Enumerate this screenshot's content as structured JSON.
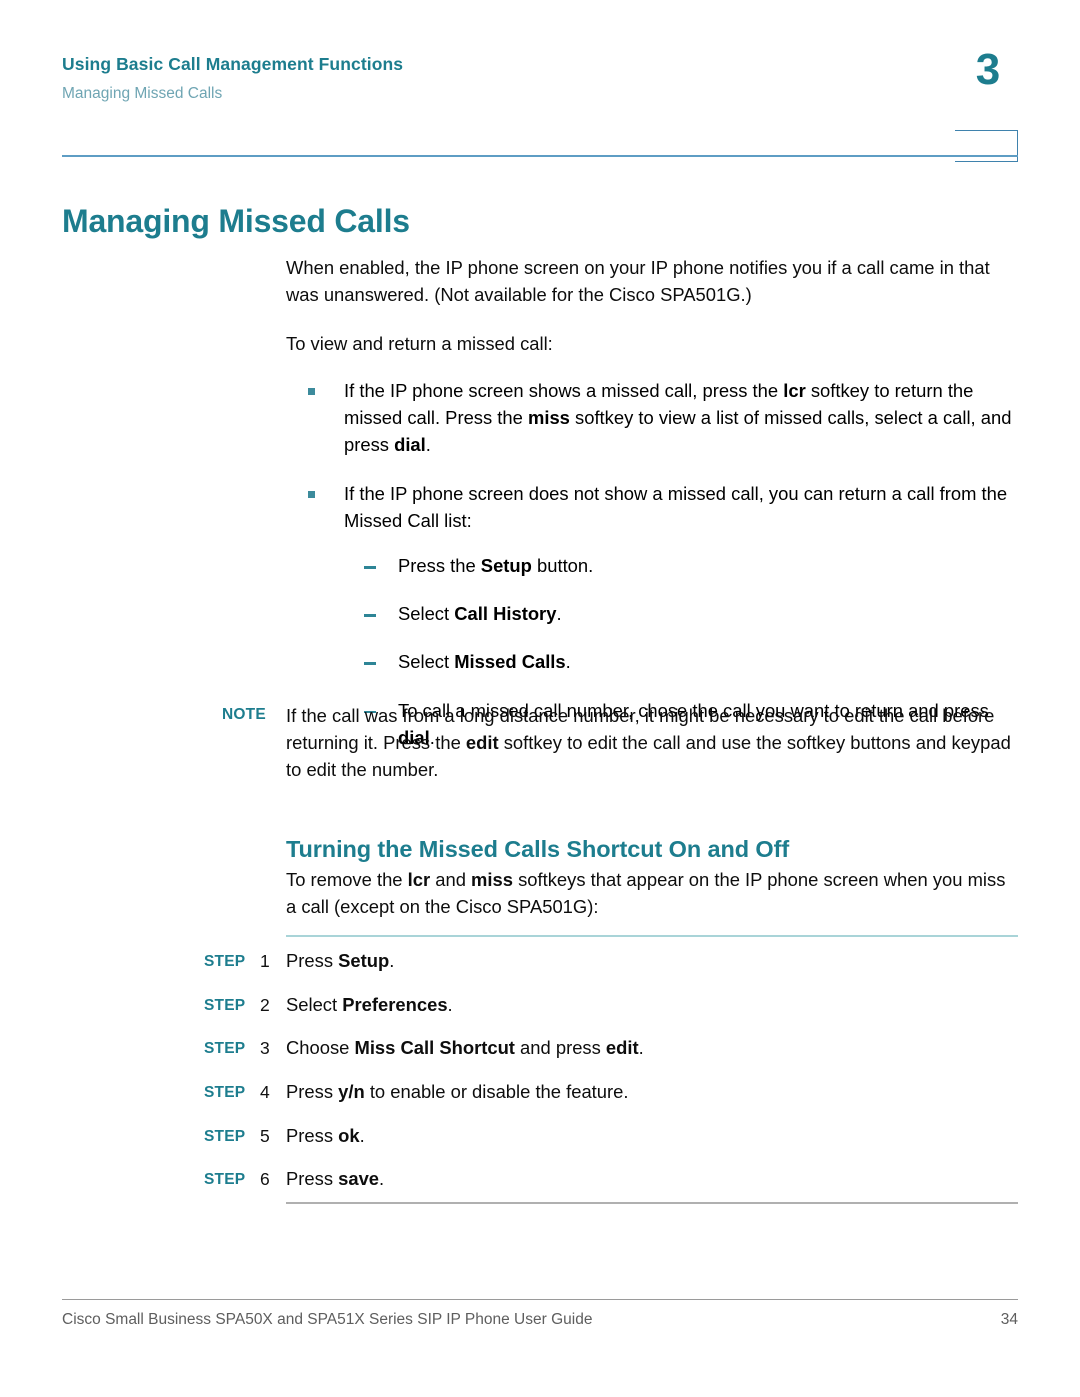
{
  "header": {
    "running_title": "Using Basic Call Management Functions",
    "running_subtitle": "Managing Missed Calls",
    "chapter_number": "3"
  },
  "page_title": "Managing Missed Calls",
  "body": {
    "intro_paragraph": "When enabled, the IP phone screen on your IP phone notifies you if a call came in that was unanswered. (Not available for the Cisco SPA501G.)",
    "lead_in": "To view and return a missed call:",
    "bullets": [
      {
        "segments": [
          {
            "text": "If the IP phone screen shows a missed call, press the ",
            "bold": false
          },
          {
            "text": "lcr",
            "bold": true
          },
          {
            "text": " softkey to return the missed call. Press the ",
            "bold": false
          },
          {
            "text": "miss",
            "bold": true
          },
          {
            "text": " softkey to view a list of missed calls, select a call, and press ",
            "bold": false
          },
          {
            "text": "dial",
            "bold": true
          },
          {
            "text": ".",
            "bold": false
          }
        ]
      },
      {
        "segments": [
          {
            "text": "If the IP phone screen does not show a missed call, you can return a call from the Missed Call list:",
            "bold": false
          }
        ],
        "sub_items": [
          [
            {
              "text": "Press the ",
              "bold": false
            },
            {
              "text": "Setup",
              "bold": true
            },
            {
              "text": " button.",
              "bold": false
            }
          ],
          [
            {
              "text": "Select ",
              "bold": false
            },
            {
              "text": "Call History",
              "bold": true
            },
            {
              "text": ".",
              "bold": false
            }
          ],
          [
            {
              "text": "Select ",
              "bold": false
            },
            {
              "text": "Missed Calls",
              "bold": true
            },
            {
              "text": ".",
              "bold": false
            }
          ],
          [
            {
              "text": "To call a missed call number, chose the call you want to return and press ",
              "bold": false
            },
            {
              "text": "dial",
              "bold": true
            },
            {
              "text": ".",
              "bold": false
            }
          ]
        ]
      }
    ]
  },
  "note": {
    "label": "NOTE",
    "segments": [
      {
        "text": "If the call was from a long distance number, it might be necessary to edit the call before returning it. Press the ",
        "bold": false
      },
      {
        "text": "edit",
        "bold": true
      },
      {
        "text": " softkey to edit the call and use the softkey buttons and keypad to edit the number.",
        "bold": false
      }
    ]
  },
  "subsection": {
    "title": "Turning the Missed Calls Shortcut On and Off",
    "intro_segments": [
      {
        "text": "To remove the ",
        "bold": false
      },
      {
        "text": "lcr",
        "bold": true
      },
      {
        "text": " and ",
        "bold": false
      },
      {
        "text": "miss",
        "bold": true
      },
      {
        "text": " softkeys that appear on the IP phone screen when you miss a call (except on the Cisco SPA501G):",
        "bold": false
      }
    ]
  },
  "steps": {
    "label": "STEP",
    "items": [
      {
        "number": "1",
        "segments": [
          {
            "text": "Press ",
            "bold": false
          },
          {
            "text": "Setup",
            "bold": true
          },
          {
            "text": ".",
            "bold": false
          }
        ]
      },
      {
        "number": "2",
        "segments": [
          {
            "text": "Select ",
            "bold": false
          },
          {
            "text": "Preferences",
            "bold": true
          },
          {
            "text": ".",
            "bold": false
          }
        ]
      },
      {
        "number": "3",
        "segments": [
          {
            "text": "Choose ",
            "bold": false
          },
          {
            "text": "Miss Call Shortcut",
            "bold": true
          },
          {
            "text": " and press ",
            "bold": false
          },
          {
            "text": "edit",
            "bold": true
          },
          {
            "text": ".",
            "bold": false
          }
        ]
      },
      {
        "number": "4",
        "segments": [
          {
            "text": "Press ",
            "bold": false
          },
          {
            "text": "y/n",
            "bold": true
          },
          {
            "text": " to enable or disable the feature.",
            "bold": false
          }
        ]
      },
      {
        "number": "5",
        "segments": [
          {
            "text": "Press ",
            "bold": false
          },
          {
            "text": "ok",
            "bold": true
          },
          {
            "text": ".",
            "bold": false
          }
        ]
      },
      {
        "number": "6",
        "segments": [
          {
            "text": "Press ",
            "bold": false
          },
          {
            "text": "save",
            "bold": true
          },
          {
            "text": ".",
            "bold": false
          }
        ]
      }
    ]
  },
  "footer": {
    "text": "Cisco Small Business SPA50X and SPA51X Series SIP IP Phone User Guide",
    "page_number": "34"
  },
  "colors": {
    "heading_teal": "#1d7d8e",
    "muted_teal": "#6fa5b3",
    "rule_blue": "#5e9dc4",
    "rule_light_teal": "#a9d4d8",
    "rule_gray": "#b0b0b0",
    "bullet_teal": "#3c8b9c",
    "footer_gray": "#5e5e5e"
  }
}
